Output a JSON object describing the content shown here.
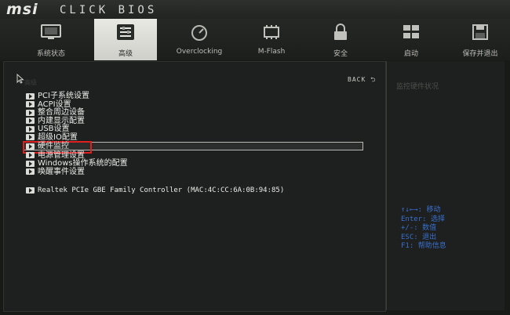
{
  "header": {
    "logo": "msi",
    "product": "CLICK BIOS"
  },
  "tabs": [
    {
      "label": "系统状态",
      "icon": "monitor-icon",
      "active": false
    },
    {
      "label": "高级",
      "icon": "advanced-settings-icon",
      "active": true
    },
    {
      "label": "Overclocking",
      "icon": "speedometer-icon",
      "active": false
    },
    {
      "label": "M-Flash",
      "icon": "flash-chip-icon",
      "active": false
    },
    {
      "label": "安全",
      "icon": "lock-icon",
      "active": false
    },
    {
      "label": "启动",
      "icon": "boot-devices-icon",
      "active": false
    },
    {
      "label": "保存并退出",
      "icon": "save-exit-icon",
      "active": false
    }
  ],
  "main": {
    "back_label": "BACK ⮌",
    "section_label": "高级",
    "items": [
      {
        "label": "PCI子系统设置"
      },
      {
        "label": "ACPI设置"
      },
      {
        "label": "整合周边设备"
      },
      {
        "label": "内建显示配置"
      },
      {
        "label": "USB设置"
      },
      {
        "label": "超级IO配置"
      },
      {
        "label": "硬件监控",
        "selected": true
      },
      {
        "label": "电源管理设置"
      },
      {
        "label": "Windows操作系统的配置"
      },
      {
        "label": "唤醒事件设置"
      }
    ],
    "network_item": "Realtek PCIe GBE Family Controller (MAC:4C:CC:6A:0B:94:85)"
  },
  "side_panel": {
    "title": "监控硬件状况",
    "help": [
      {
        "key": "↑↓←→:",
        "desc": "移动"
      },
      {
        "key": "Enter:",
        "desc": "选择"
      },
      {
        "key": "+/-:",
        "desc": "数值"
      },
      {
        "key": "ESC:",
        "desc": "退出"
      },
      {
        "key": "F1:",
        "desc": "帮助信息"
      }
    ]
  },
  "colors": {
    "background": "#181a18",
    "text": "#ececea",
    "active_tab": "#e0e0dc",
    "help_text": "#3a6fd0",
    "highlight_box": "#e02020"
  }
}
